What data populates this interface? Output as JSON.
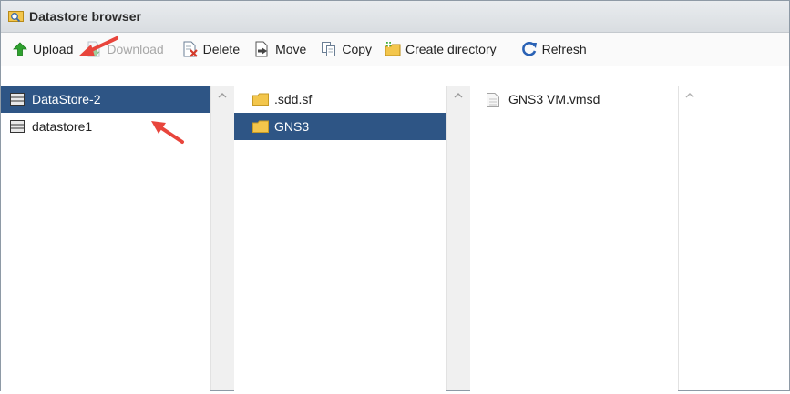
{
  "window": {
    "title": "Datastore browser",
    "title_icon": "datastore-browser-icon"
  },
  "toolbar": {
    "upload": "Upload",
    "download": "Download",
    "delete": "Delete",
    "move": "Move",
    "copy": "Copy",
    "create_directory": "Create directory",
    "refresh": "Refresh"
  },
  "datastores": {
    "items": [
      {
        "label": "DataStore-2",
        "selected": true,
        "icon": "datastore-icon"
      },
      {
        "label": "datastore1",
        "selected": false,
        "icon": "datastore-icon"
      }
    ]
  },
  "folders": {
    "items": [
      {
        "label": ".sdd.sf",
        "selected": false,
        "icon": "folder-icon"
      },
      {
        "label": "GNS3",
        "selected": true,
        "icon": "folder-icon"
      }
    ]
  },
  "files": {
    "items": [
      {
        "label": "GNS3 VM.vmsd",
        "selected": false,
        "icon": "file-icon"
      }
    ]
  },
  "colors": {
    "selection": "#2e5585",
    "annotation_arrow": "#e8453c"
  }
}
